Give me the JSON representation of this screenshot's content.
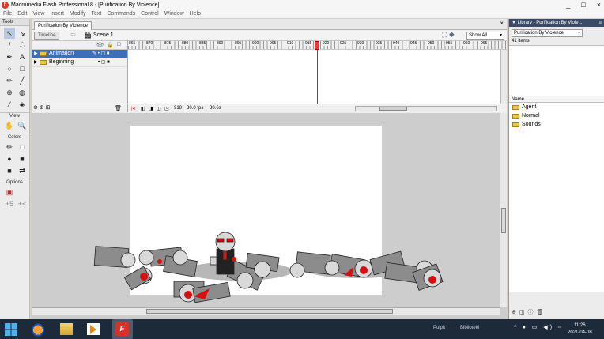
{
  "window": {
    "title": "Macromedia Flash Professional 8 - [Purification By Violence]",
    "app_logo": "F",
    "controls": [
      "_",
      "□",
      "×"
    ]
  },
  "menu": [
    "File",
    "Edit",
    "View",
    "Insert",
    "Modify",
    "Text",
    "Commands",
    "Control",
    "Window",
    "Help"
  ],
  "tools": {
    "title": "Tools",
    "items": [
      "↖",
      "↘",
      "/",
      "ℒ",
      "✒",
      "A",
      "○",
      "□",
      "✏",
      "╱",
      "⊕",
      "◍",
      "⁄",
      "◈"
    ],
    "view_label": "View",
    "view_items": [
      "✋",
      "🔍"
    ],
    "colors_label": "Colors",
    "color_items": [
      "✏",
      "■",
      "●",
      "■",
      "■",
      "⇄",
      "■"
    ],
    "options_label": "Options",
    "option_items": [
      "▣",
      "+5",
      "+<"
    ]
  },
  "document": {
    "tab": "Purification By Violence",
    "tab_close": "×",
    "timeline_button": "Timeline",
    "back_arrow": "⇦",
    "scene_icon": "🎬",
    "scene": "Scene 1",
    "edit_icons": "⛶ ◆",
    "zoom": "Show All",
    "zoom_arrow": "▾"
  },
  "timeline": {
    "header_icons": [
      "👁",
      "🔒",
      "□"
    ],
    "layers": [
      {
        "arrow": "▶",
        "name": "Animation",
        "marks": "✎  •  ▢  ■",
        "selected": true
      },
      {
        "arrow": "▶",
        "name": "Beginning",
        "marks": "•  ▢  ■",
        "selected": false
      }
    ],
    "footer_icons": "⊕ ⊕ ⊞",
    "trash": "🗑",
    "ticks": [
      "865",
      "870",
      "875",
      "880",
      "885",
      "890",
      "895",
      "900",
      "905",
      "910",
      "915",
      "920",
      "925",
      "930",
      "935",
      "940",
      "945",
      "950",
      "955",
      "960",
      "965"
    ],
    "current_frame": "918",
    "fps": "30.0 fps",
    "elapsed": "30.6s",
    "footer_ctrls": [
      "|◂",
      "◧",
      "◨",
      "◫",
      "◳"
    ]
  },
  "library": {
    "header": "▼ Library - Purification By Viole...",
    "header_close": "≡",
    "document": "Purification By Violence",
    "select_arrow": "▾",
    "count": "41 items",
    "column": "Name",
    "items": [
      "Agent",
      "Normal",
      "Sounds"
    ],
    "footer_icons": [
      "⊕",
      "◫",
      "ⓘ",
      "🗑"
    ]
  },
  "taskbar": {
    "search_hint": "Pulpit",
    "library_label": "Biblioteki",
    "tray": "^ ♦ ▭ ◀) ▫",
    "time": "11:26",
    "date": "2021-04-08"
  }
}
